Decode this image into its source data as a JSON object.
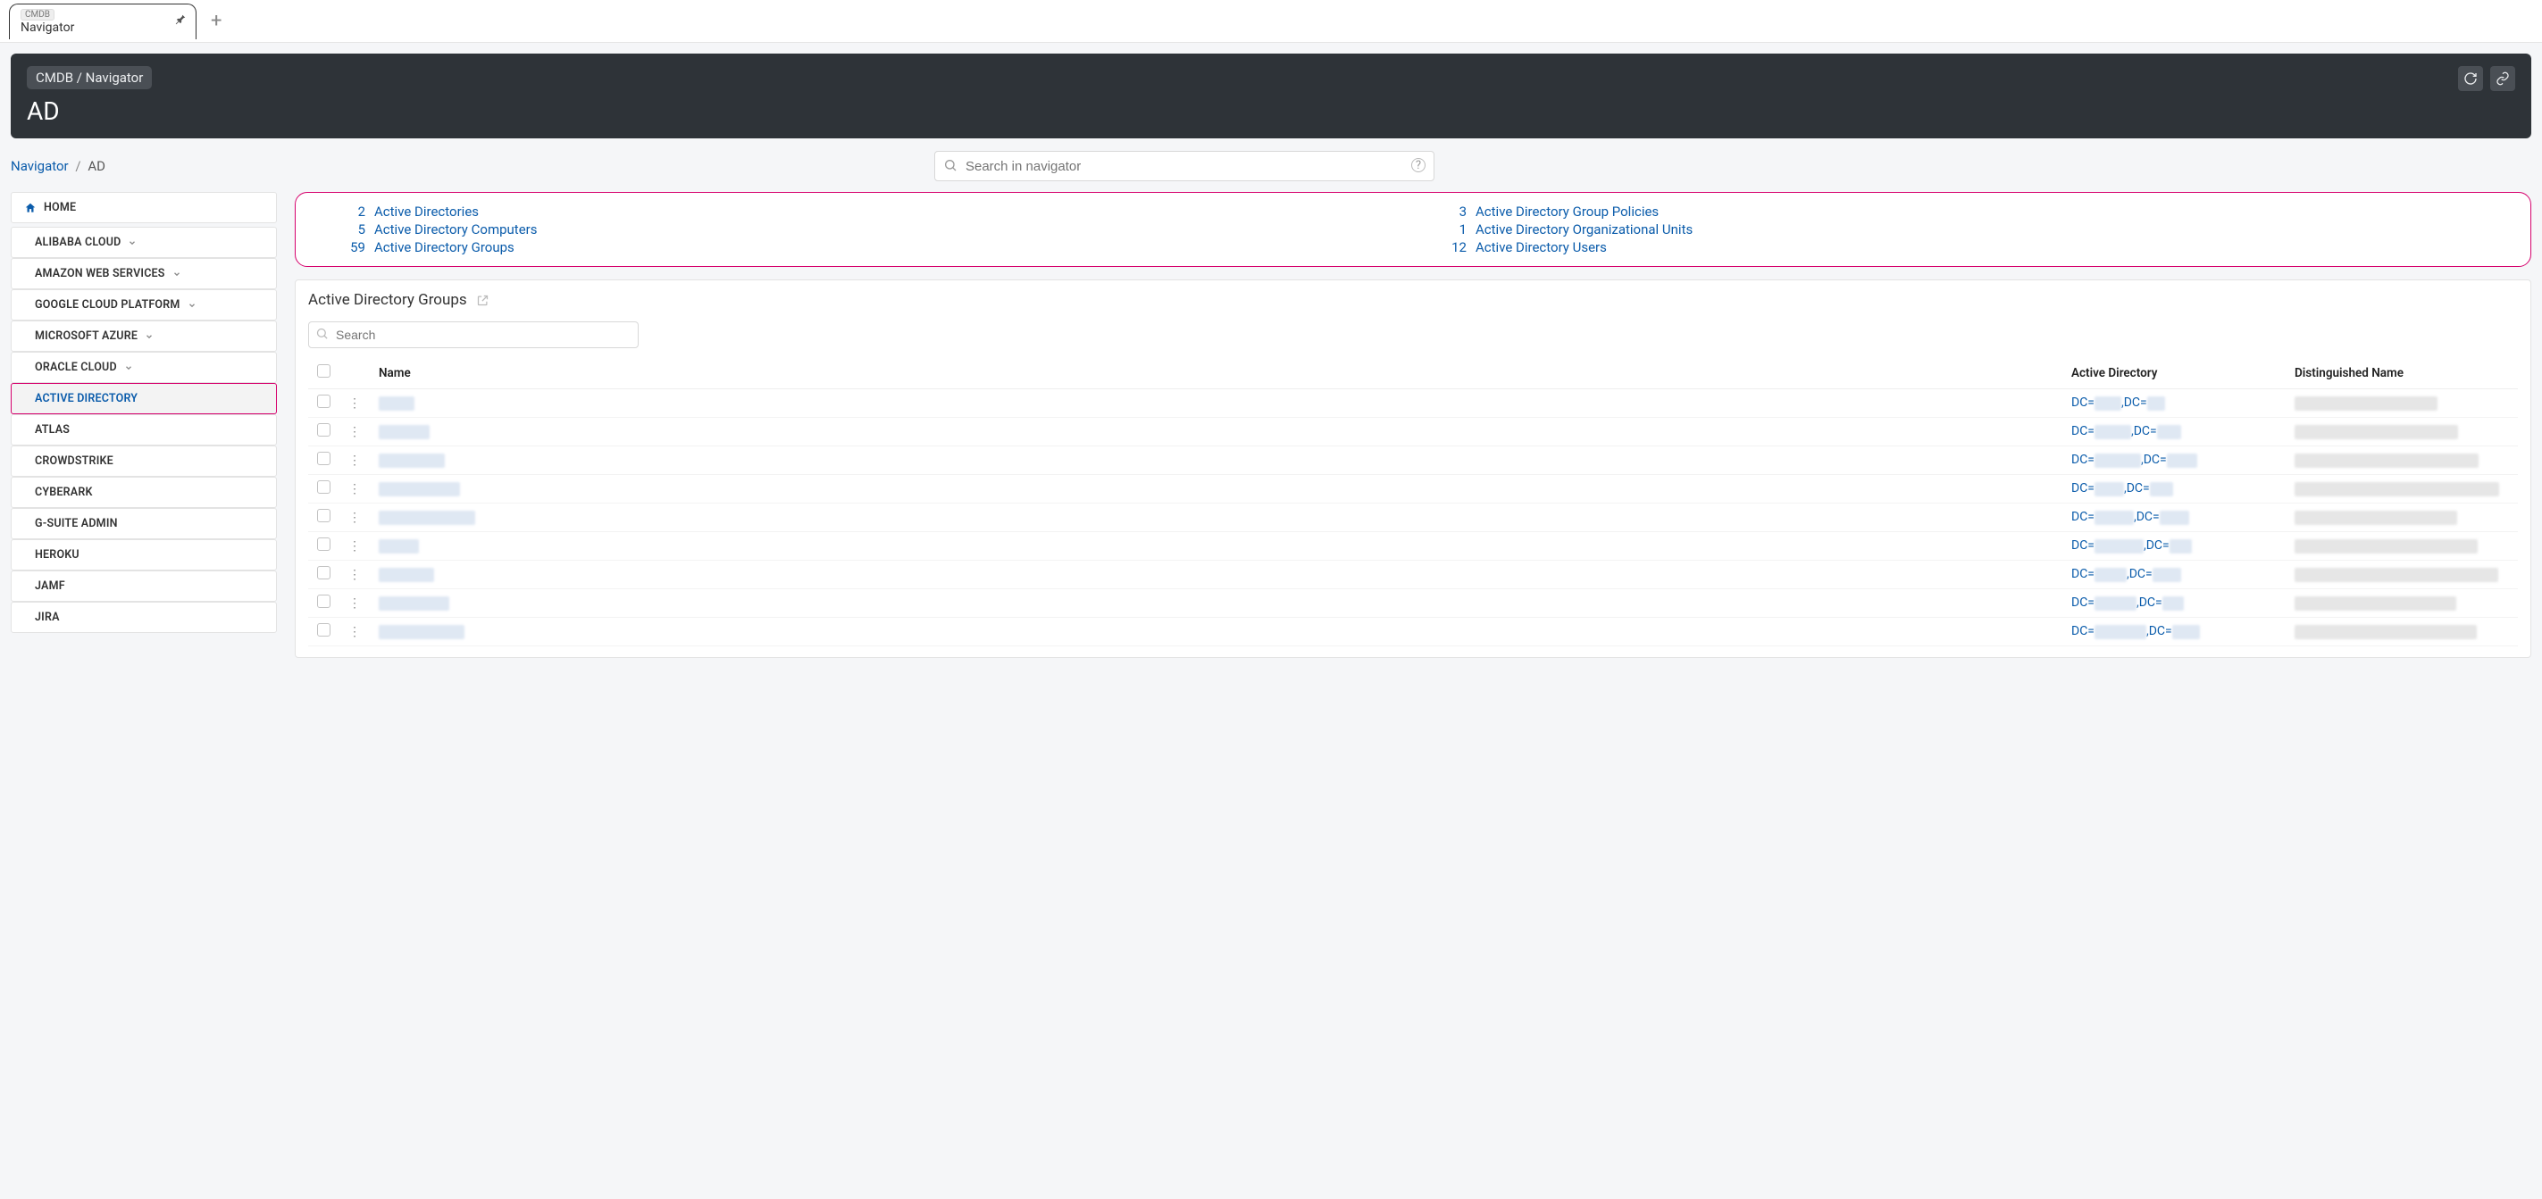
{
  "tab": {
    "tag": "CMDB",
    "label": "Navigator"
  },
  "header": {
    "breadcrumb": "CMDB / Navigator",
    "title": "AD"
  },
  "breadcrumb": {
    "root": "Navigator",
    "current": "AD"
  },
  "search": {
    "placeholder": "Search in navigator"
  },
  "sidebar": {
    "home": "HOME",
    "items": [
      {
        "label": "ALIBABA CLOUD",
        "expandable": true
      },
      {
        "label": "AMAZON WEB SERVICES",
        "expandable": true
      },
      {
        "label": "GOOGLE CLOUD PLATFORM",
        "expandable": true
      },
      {
        "label": "MICROSOFT AZURE",
        "expandable": true
      },
      {
        "label": "ORACLE CLOUD",
        "expandable": true
      },
      {
        "label": "ACTIVE DIRECTORY",
        "expandable": false,
        "active": true
      },
      {
        "label": "ATLAS",
        "expandable": false
      },
      {
        "label": "CROWDSTRIKE",
        "expandable": false
      },
      {
        "label": "CYBERARK",
        "expandable": false
      },
      {
        "label": "G-SUITE ADMIN",
        "expandable": false
      },
      {
        "label": "HEROKU",
        "expandable": false
      },
      {
        "label": "JAMF",
        "expandable": false
      },
      {
        "label": "JIRA",
        "expandable": false
      }
    ]
  },
  "summary": {
    "left": [
      {
        "count": "2",
        "label": "Active Directories"
      },
      {
        "count": "5",
        "label": "Active Directory Computers"
      },
      {
        "count": "59",
        "label": "Active Directory Groups"
      }
    ],
    "right": [
      {
        "count": "3",
        "label": "Active Directory Group Policies"
      },
      {
        "count": "1",
        "label": "Active Directory Organizational Units"
      },
      {
        "count": "12",
        "label": "Active Directory Users"
      }
    ]
  },
  "table": {
    "title": "Active Directory Groups",
    "search_placeholder": "Search",
    "columns": {
      "name": "Name",
      "ad": "Active Directory",
      "dn": "Distinguished Name"
    },
    "ad_prefix1": "DC=",
    "ad_prefix2": ",DC=",
    "row_count": 9
  }
}
